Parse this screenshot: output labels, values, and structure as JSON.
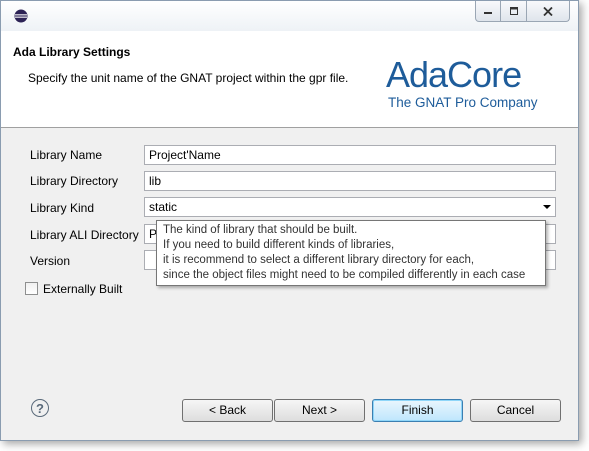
{
  "window": {
    "controls": {
      "minimize": "minimize-icon",
      "maximize": "maximize-icon",
      "close": "close-icon"
    }
  },
  "header": {
    "title": "Ada Library Settings",
    "description": "Specify the unit name of the GNAT project within the gpr file.",
    "logo_main": "AdaCore",
    "logo_sub": "The GNAT Pro Company",
    "logo_color": "#1e5c9a"
  },
  "form": {
    "library_name": {
      "label": "Library Name",
      "value": "Project'Name"
    },
    "library_directory": {
      "label": "Library Directory",
      "value": "lib"
    },
    "library_kind": {
      "label": "Library Kind",
      "value": "static"
    },
    "library_ali_directory": {
      "label": "Library ALI Directory",
      "value": "P"
    },
    "version": {
      "label": "Version",
      "value": ""
    },
    "externally_built": {
      "label": "Externally Built",
      "checked": false
    }
  },
  "tooltip": {
    "lines": [
      "The kind of library that should be built.",
      "If you need to build different kinds of libraries,",
      "it is recommend to select a different library directory for each,",
      "since the object files might need to be compiled differently in each case"
    ]
  },
  "buttons": {
    "help": "?",
    "back": "< Back",
    "next": "Next >",
    "finish": "Finish",
    "cancel": "Cancel"
  }
}
